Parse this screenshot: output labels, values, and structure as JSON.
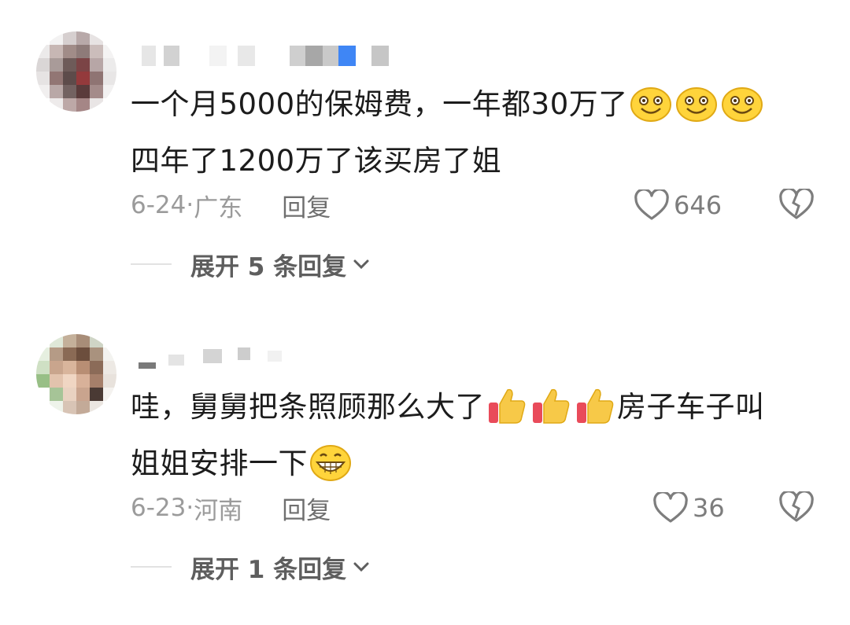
{
  "comments": [
    {
      "username": "",
      "text_line1": "一个月5000的保姆费，一年都30万了",
      "text_line1_emojis": [
        "smile-emoji",
        "smile-emoji",
        "smile-emoji"
      ],
      "text_line2": "四年了1200万了该买房了姐",
      "date": "6-24",
      "location": "广东",
      "reply_label": "回复",
      "likes": "646",
      "expand_label": "展开 5 条回复"
    },
    {
      "username": "",
      "text_line1_a": "哇，舅舅把条照顾那么大了",
      "text_line1_emojis": [
        "thumbs-up-emoji",
        "thumbs-up-emoji",
        "thumbs-up-emoji"
      ],
      "text_line1_b": "房子车子叫",
      "text_line2": "姐姐安排一下",
      "text_line2_emojis": [
        "grin-emoji"
      ],
      "date": "6-23",
      "location": "河南",
      "reply_label": "回复",
      "likes": "36",
      "expand_label": "展开 1 条回复"
    }
  ],
  "colors": {
    "text": "#1c1c1c",
    "meta": "#9b9b9b",
    "reply": "#6f6f6f",
    "emoji_face": "#ffd43b",
    "thumb": "#f7c948"
  }
}
